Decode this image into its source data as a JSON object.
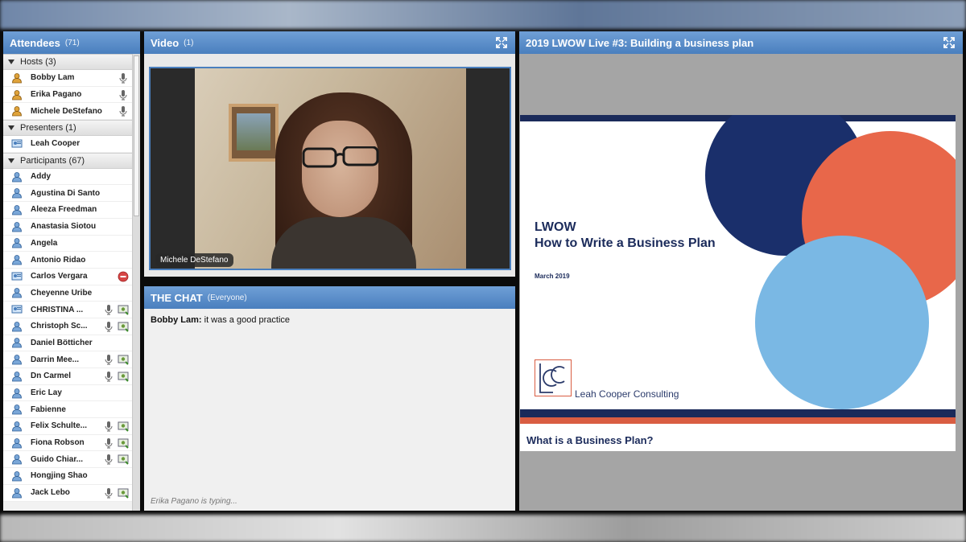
{
  "attendees": {
    "title": "Attendees",
    "count": "(71)",
    "sections": {
      "hosts": "Hosts (3)",
      "presenters": "Presenters (1)",
      "participants": "Participants (67)"
    },
    "hosts": [
      "Bobby Lam",
      "Erika Pagano",
      "Michele DeStefano"
    ],
    "presenters": [
      "Leah Cooper"
    ],
    "participants": [
      "Addy",
      "Agustina Di Santo",
      "Aleeza Freedman",
      "Anastasia Siotou",
      "Angela",
      "Antonio Ridao",
      "Carlos Vergara",
      "Cheyenne Uribe",
      "CHRISTINA ...",
      "Christoph Sc...",
      "Daniel Bötticher",
      "Darrin Mee...",
      "Dn Carmel",
      "Eric Lay",
      "Fabienne",
      "Felix Schulte...",
      "Fiona Robson",
      "Guido Chiar...",
      "Hongjing Shao",
      "Jack Lebo"
    ]
  },
  "video": {
    "title": "Video",
    "count": "(1)",
    "speaker_label": "Michele DeStefano"
  },
  "chat": {
    "title": "THE CHAT",
    "scope": "(Everyone)",
    "message_author": "Bobby Lam:",
    "message_text": " it was a good practice",
    "typing": "Erika Pagano is typing..."
  },
  "share": {
    "title": "2019 LWOW Live #3: Building a business plan",
    "slide_title_line1": "LWOW",
    "slide_title_line2": "How to Write a Business Plan",
    "slide_date": "March 2019",
    "logo_text": "Leah Cooper Consulting",
    "next_slide_title": "What is a Business Plan?"
  },
  "colors": {
    "header_blue": "#4a7fbe",
    "navy": "#1b2b5b",
    "coral": "#e8674a",
    "light_blue": "#7ab8e4"
  }
}
